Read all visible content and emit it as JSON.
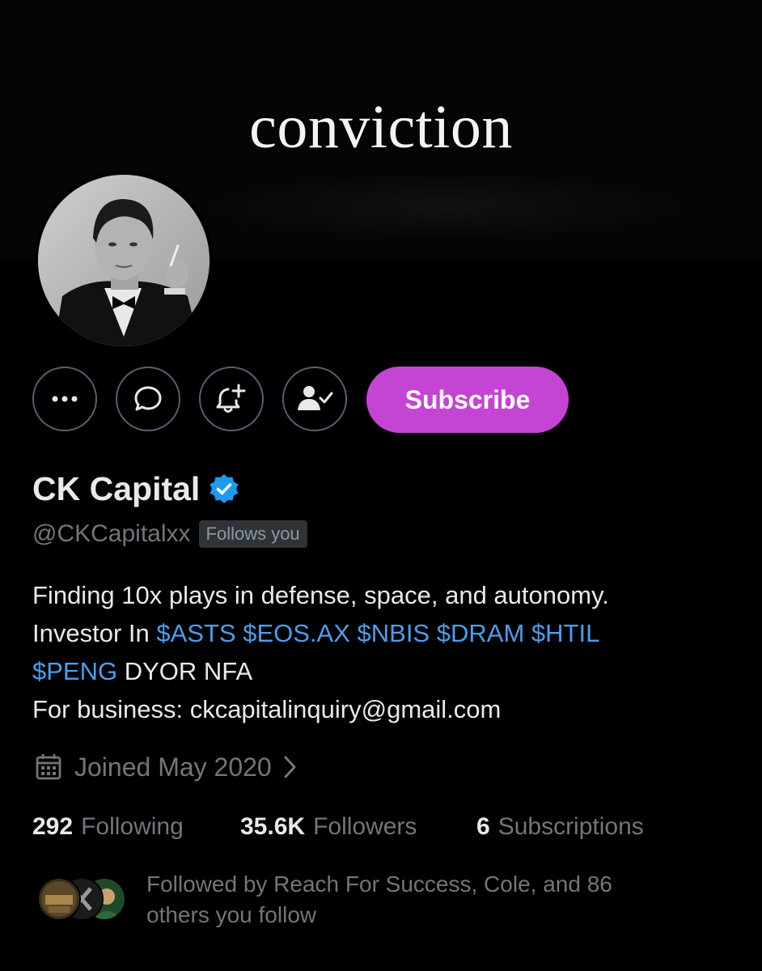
{
  "banner": {
    "text": "conviction"
  },
  "profile": {
    "display_name": "CK Capital",
    "verified": true,
    "handle": "@CKCapitalxx",
    "follows_you_badge": "Follows you",
    "avatar_icon": "profile-photo"
  },
  "actions": {
    "more_icon": "more-icon",
    "message_icon": "message-icon",
    "notify_icon": "bell-plus-icon",
    "following_icon": "person-check-icon",
    "subscribe_label": "Subscribe"
  },
  "bio": {
    "line1": "Finding 10x plays in defense, space, and autonomy.",
    "line2_prefix": "Investor In ",
    "cashtags_line2": [
      "$ASTS",
      "$EOS.AX",
      "$NBIS",
      "$DRAM",
      "$HTIL"
    ],
    "cashtag_line3": "$PENG",
    "line3_suffix": " DYOR NFA",
    "line4": "For business: ckcapitalinquiry@gmail.com"
  },
  "joined": {
    "text": "Joined May 2020"
  },
  "stats": {
    "following_count": "292",
    "following_label": "Following",
    "followers_count": "35.6K",
    "followers_label": "Followers",
    "subscriptions_count": "6",
    "subscriptions_label": "Subscriptions"
  },
  "followed_by": {
    "line1": "Followed by Reach For Success, Cole, and 86",
    "line2": "others you follow"
  },
  "colors": {
    "background": "#000000",
    "subscribe": "#c444d4",
    "link": "#4a9eed",
    "verified": "#1d9bf0",
    "muted": "#71767b"
  }
}
